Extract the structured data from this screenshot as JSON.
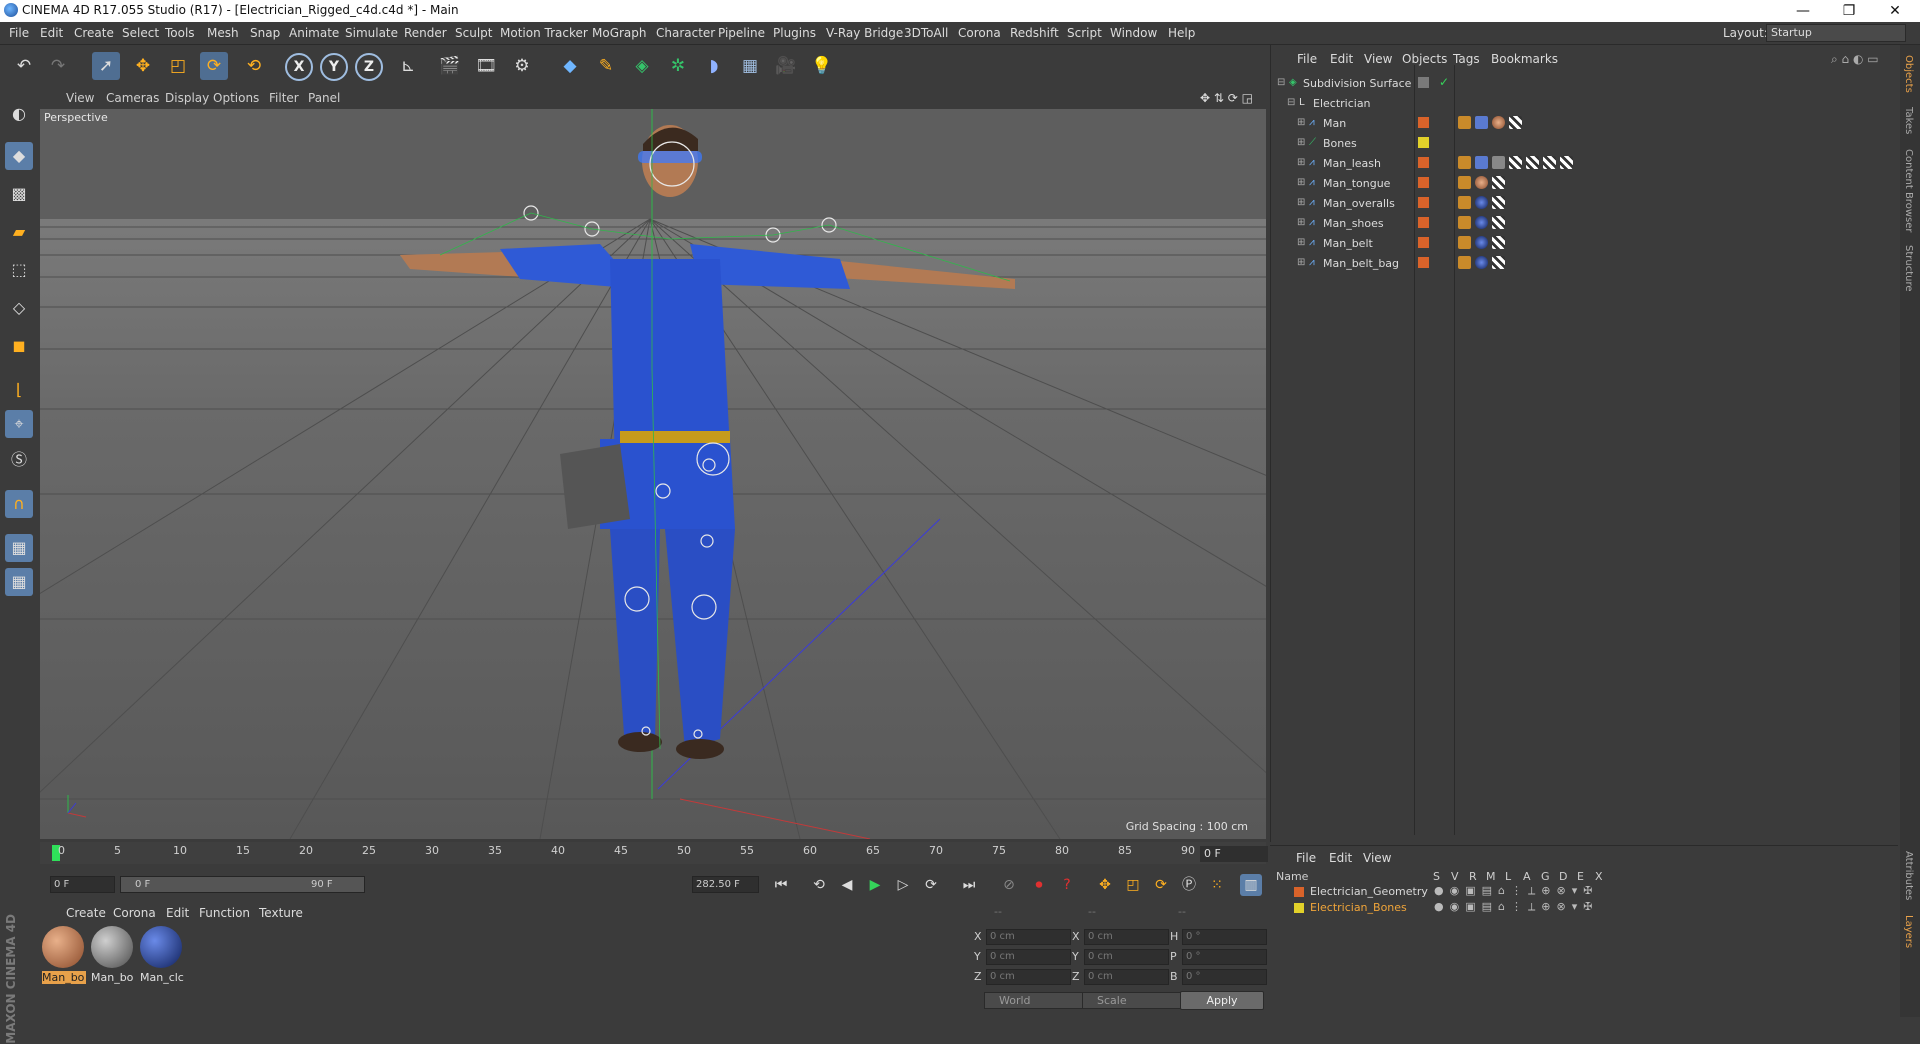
{
  "window": {
    "title": "CINEMA 4D R17.055 Studio (R17) - [Electrician_Rigged_c4d.c4d *] - Main",
    "minimize": "—",
    "restore": "❐",
    "close": "✕"
  },
  "menubar": {
    "items": [
      "File",
      "Edit",
      "Create",
      "Select",
      "Tools",
      "Mesh",
      "Snap",
      "Animate",
      "Simulate",
      "Render",
      "Sculpt",
      "Motion Tracker",
      "MoGraph",
      "Character",
      "Pipeline",
      "Plugins",
      "V-Ray Bridge",
      "3DToAll",
      "Corona",
      "Redshift",
      "Script",
      "Window",
      "Help"
    ],
    "layout_label": "Layout:",
    "layout_value": "Startup"
  },
  "viewport": {
    "menu": [
      "View",
      "Cameras",
      "Display",
      "Options",
      "Filter",
      "Panel"
    ],
    "label": "Perspective",
    "grid_spacing": "Grid Spacing : 100 cm"
  },
  "timeline": {
    "ticks": [
      "0",
      "5",
      "10",
      "15",
      "20",
      "25",
      "30",
      "35",
      "40",
      "45",
      "50",
      "55",
      "60",
      "65",
      "70",
      "75",
      "80",
      "85",
      "90"
    ],
    "current_frame": "0 F",
    "start_field": "0 F",
    "range_start": "0 F",
    "range_end": "90 F",
    "end_field": "282.50 F"
  },
  "materials": {
    "menu": [
      "Create",
      "Corona",
      "Edit",
      "Function",
      "Texture"
    ],
    "items": [
      {
        "label": "Man_bo",
        "selected": true
      },
      {
        "label": "Man_bo",
        "selected": false
      },
      {
        "label": "Man_clc",
        "selected": false
      }
    ]
  },
  "coordinates": {
    "headers": [
      "--",
      "--",
      "--"
    ],
    "rows": [
      {
        "a": "X",
        "av": "0 cm",
        "b": "X",
        "bv": "0 cm",
        "c": "H",
        "cv": "0 °"
      },
      {
        "a": "Y",
        "av": "0 cm",
        "b": "Y",
        "bv": "0 cm",
        "c": "P",
        "cv": "0 °"
      },
      {
        "a": "Z",
        "av": "0 cm",
        "b": "Z",
        "bv": "0 cm",
        "c": "B",
        "cv": "0 °"
      }
    ],
    "world": "World",
    "scale": "Scale",
    "apply": "Apply"
  },
  "object_manager": {
    "menu": [
      "File",
      "Edit",
      "View",
      "Objects",
      "Tags",
      "Bookmarks"
    ],
    "objects": [
      {
        "name": "Subdivision Surface",
        "color": "#8a8a8a",
        "depth": 0
      },
      {
        "name": "Electrician",
        "color": "#8a8a8a",
        "depth": 1
      },
      {
        "name": "Man",
        "color": "#d9632a",
        "depth": 2
      },
      {
        "name": "Bones",
        "color": "#e2d12a",
        "depth": 2
      },
      {
        "name": "Man_leash",
        "color": "#d9632a",
        "depth": 2
      },
      {
        "name": "Man_tongue",
        "color": "#d9632a",
        "depth": 2
      },
      {
        "name": "Man_overalls",
        "color": "#d9632a",
        "depth": 2
      },
      {
        "name": "Man_shoes",
        "color": "#d9632a",
        "depth": 2
      },
      {
        "name": "Man_belt",
        "color": "#d9632a",
        "depth": 2
      },
      {
        "name": "Man_belt_bag",
        "color": "#d9632a",
        "depth": 2
      }
    ]
  },
  "layer_manager": {
    "menu": [
      "File",
      "Edit",
      "View"
    ],
    "columns": [
      "Name",
      "S",
      "V",
      "R",
      "M",
      "L",
      "A",
      "G",
      "D",
      "E",
      "X"
    ],
    "layers": [
      {
        "name": "Electrician_Geometry",
        "color": "#d9632a"
      },
      {
        "name": "Electrician_Bones",
        "color": "#e2d12a"
      }
    ]
  },
  "side_tabs": [
    "Objects",
    "Takes",
    "Content Browser",
    "Structure"
  ],
  "side_tabs_lower": [
    "Attributes",
    "Layers"
  ],
  "brand": "MAXON CINEMA 4D"
}
